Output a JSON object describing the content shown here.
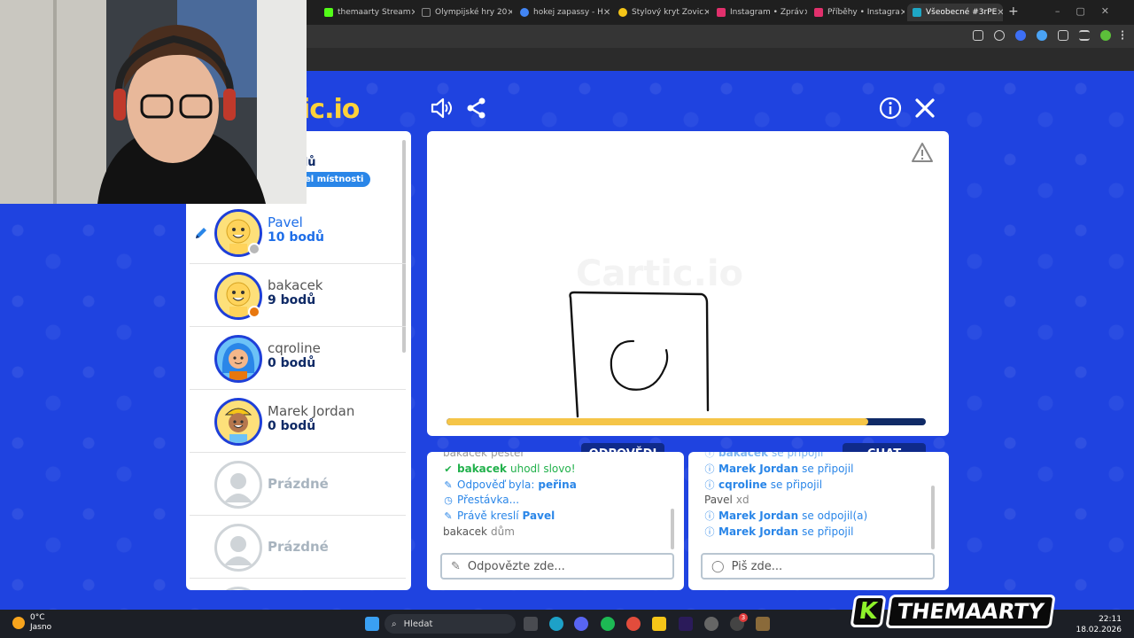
{
  "browser": {
    "tabs": [
      {
        "label": "themaarty Stream",
        "fav": "#53fc18"
      },
      {
        "label": "Olympijské hry 20",
        "fav": "#222222"
      },
      {
        "label": "hokej zapassy - H",
        "fav": "#4285f4"
      },
      {
        "label": "Stylový kryt Zovic",
        "fav": "#f5c518"
      },
      {
        "label": "Instagram • Zpráv",
        "fav": "#e1306c"
      },
      {
        "label": "Příběhy • Instagra",
        "fav": "#e1306c"
      },
      {
        "label": "Všeobecné #3rPE",
        "fav": "#1ea7c5"
      }
    ],
    "new_tab": "+"
  },
  "game": {
    "logo": "ic.io",
    "room": {
      "points": "dů",
      "badge": "el místnosti"
    },
    "players": [
      {
        "name": "Pavel",
        "points": "10 bodů",
        "drawing": true,
        "status": "#b8b8b8"
      },
      {
        "name": "bakacek",
        "points": "9 bodů",
        "drawing": false,
        "status": "#e8770e"
      },
      {
        "name": "cqroline",
        "points": "0 bodů",
        "drawing": false,
        "status": ""
      },
      {
        "name": "Marek Jordan",
        "points": "0 bodů",
        "drawing": false,
        "status": ""
      }
    ],
    "empty_slot": "Prázdné",
    "watermark": "Cartic.io",
    "timer_fraction": 0.88,
    "answers_tab": "ODPOVĚDI",
    "chat_tab": "CHAT",
    "answers": [
      {
        "user": "bakacek",
        "text": "pešter"
      },
      {
        "user": "bakacek",
        "text": "uhodl slovo!"
      },
      {
        "label": "Odpověď byla:",
        "word": "peřina"
      },
      {
        "text": "Přestávka..."
      },
      {
        "label": "Právě kreslí",
        "user": "Pavel"
      },
      {
        "user": "bakacek",
        "text": "dům"
      }
    ],
    "chat": [
      {
        "user": "bakacek",
        "text": "se připojil"
      },
      {
        "user": "Marek Jordan",
        "text": "se připojil"
      },
      {
        "user": "cqroline",
        "text": "se připojil"
      },
      {
        "user": "Pavel",
        "text": "xd"
      },
      {
        "user": "Marek Jordan",
        "text": "se odpojil(a)"
      },
      {
        "user": "Marek Jordan",
        "text": "se připojil"
      }
    ],
    "answer_placeholder": "Odpovězte zde...",
    "chat_placeholder": "Piš zde..."
  },
  "taskbar": {
    "temperature": "0°C",
    "weather": "Jasno",
    "search": "Hledat",
    "time": "22:11",
    "date": "18.02.2026",
    "badge": "3"
  },
  "overlay": {
    "brand_letter": "K",
    "brand": "THEMAARTY"
  }
}
